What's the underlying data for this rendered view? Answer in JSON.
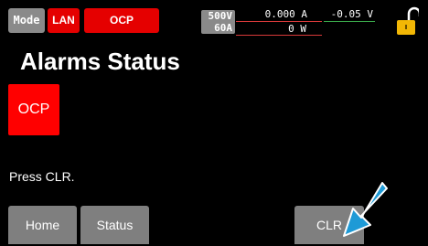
{
  "status_bar": {
    "mode": "Mode",
    "lan": "LAN",
    "ocp": "OCP",
    "rating_voltage": "500V",
    "rating_current": "60A",
    "current": "0.000 A",
    "voltage": "-0.05 V",
    "power": "0 W",
    "lock_icon": "unlocked-padlock-icon"
  },
  "main": {
    "title": "Alarms Status",
    "alarm_label": "OCP",
    "message": "Press CLR."
  },
  "softkeys": {
    "home": "Home",
    "status": "Status",
    "clr": "CLR"
  },
  "annotation": {
    "arrow_icon": "pointer-arrow-icon",
    "arrow_color": "#1e9ad6"
  },
  "colors": {
    "alarm_red": "#ff0000",
    "tag_red": "#e50000",
    "key_gray": "#7f7f7f",
    "lock_yellow": "#f2b705"
  }
}
